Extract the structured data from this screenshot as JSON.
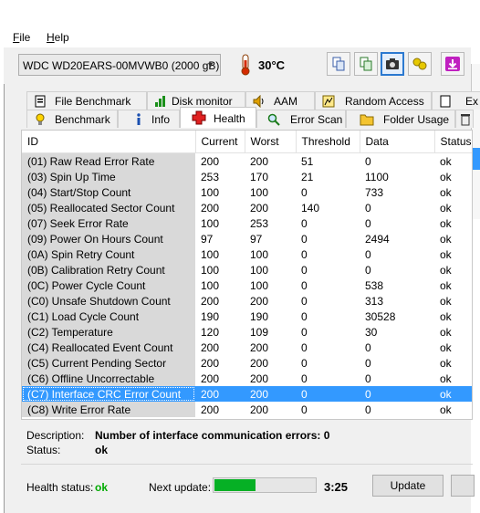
{
  "menu": {
    "file": "File",
    "file_mnemonic": "F",
    "file_rest": "ile",
    "help_mnemonic": "H",
    "help_rest": "elp"
  },
  "toolbar": {
    "drive": "WDC WD20EARS-00MVWB0 (2000 gB)",
    "temperature": "30°C",
    "icons": [
      "copy-icon",
      "copy-text-icon",
      "camera-icon",
      "compare-icon",
      "download-icon"
    ]
  },
  "tabs_back": [
    "File Benchmark",
    "Disk monitor",
    "AAM",
    "Random Access",
    "Ex"
  ],
  "tabs_front": [
    "Benchmark",
    "Info",
    "Health",
    "Error Scan",
    "Folder Usage"
  ],
  "selected_tab": "Health",
  "table": {
    "columns": [
      "ID",
      "Current",
      "Worst",
      "Threshold",
      "Data",
      "Status"
    ],
    "rows": [
      [
        "(01) Raw Read Error Rate",
        "200",
        "200",
        "51",
        "0",
        "ok"
      ],
      [
        "(03) Spin Up Time",
        "253",
        "170",
        "21",
        "1100",
        "ok"
      ],
      [
        "(04) Start/Stop Count",
        "100",
        "100",
        "0",
        "733",
        "ok"
      ],
      [
        "(05) Reallocated Sector Count",
        "200",
        "200",
        "140",
        "0",
        "ok"
      ],
      [
        "(07) Seek Error Rate",
        "100",
        "253",
        "0",
        "0",
        "ok"
      ],
      [
        "(09) Power On Hours Count",
        "97",
        "97",
        "0",
        "2494",
        "ok"
      ],
      [
        "(0A) Spin Retry Count",
        "100",
        "100",
        "0",
        "0",
        "ok"
      ],
      [
        "(0B) Calibration Retry Count",
        "100",
        "100",
        "0",
        "0",
        "ok"
      ],
      [
        "(0C) Power Cycle Count",
        "100",
        "100",
        "0",
        "538",
        "ok"
      ],
      [
        "(C0) Unsafe Shutdown Count",
        "200",
        "200",
        "0",
        "313",
        "ok"
      ],
      [
        "(C1) Load Cycle Count",
        "190",
        "190",
        "0",
        "30528",
        "ok"
      ],
      [
        "(C2) Temperature",
        "120",
        "109",
        "0",
        "30",
        "ok"
      ],
      [
        "(C4) Reallocated Event Count",
        "200",
        "200",
        "0",
        "0",
        "ok"
      ],
      [
        "(C5) Current Pending Sector",
        "200",
        "200",
        "0",
        "0",
        "ok"
      ],
      [
        "(C6) Offline Uncorrectable",
        "200",
        "200",
        "0",
        "0",
        "ok"
      ],
      [
        "(C7) Interface CRC Error Count",
        "200",
        "200",
        "0",
        "0",
        "ok"
      ],
      [
        "(C8) Write Error Rate",
        "200",
        "200",
        "0",
        "0",
        "ok"
      ]
    ],
    "selected_index": 15
  },
  "description": {
    "desc_label": "Description:",
    "desc_value": "Number of interface communication errors: 0",
    "status_label": "Status:",
    "status_value": "ok"
  },
  "statusbar": {
    "health_label": "Health status:",
    "health_value": "ok",
    "next_label": "Next update:",
    "progress_fraction": 0.42,
    "countdown": "3:25",
    "update_button": "Update"
  },
  "colors": {
    "selection": "#3399ff",
    "health_ok": "#00aa00",
    "progress": "#06b025"
  }
}
